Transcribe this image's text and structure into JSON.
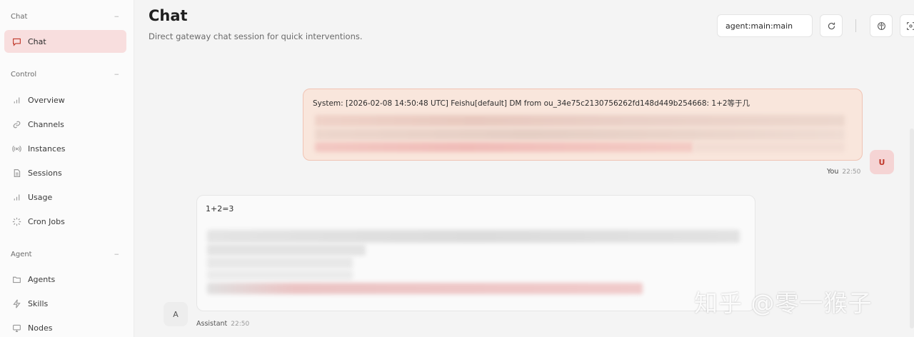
{
  "sidebar": {
    "sections": [
      {
        "title": "Chat",
        "chevron": "−"
      },
      {
        "title": "Control",
        "chevron": "−"
      },
      {
        "title": "Agent",
        "chevron": "−"
      }
    ],
    "items": [
      {
        "label": "Chat",
        "icon": "chat-bubble-icon",
        "active": true
      },
      {
        "label": "Overview",
        "icon": "bar-chart-icon"
      },
      {
        "label": "Channels",
        "icon": "link-icon"
      },
      {
        "label": "Instances",
        "icon": "broadcast-icon"
      },
      {
        "label": "Sessions",
        "icon": "document-icon"
      },
      {
        "label": "Usage",
        "icon": "bar-chart-icon"
      },
      {
        "label": "Cron Jobs",
        "icon": "spinner-icon"
      },
      {
        "label": "Agents",
        "icon": "folder-icon"
      },
      {
        "label": "Skills",
        "icon": "lightning-icon"
      },
      {
        "label": "Nodes",
        "icon": "monitor-icon"
      }
    ]
  },
  "header": {
    "title": "Chat",
    "subtitle": "Direct gateway chat session for quick interventions.",
    "session_value": "agent:main:main"
  },
  "messages": {
    "user": {
      "text": "System: [2026-02-08 14:50:48 UTC] Feishu[default] DM from ou_34e75c2130756262fd148d449b254668: 1+2等于几",
      "avatar": "U",
      "sender": "You",
      "time": "22:50"
    },
    "assistant": {
      "text": "1+2=3",
      "avatar": "A",
      "sender": "Assistant",
      "time": "22:50"
    }
  },
  "watermark": "知乎 @零一猴子",
  "colors": {
    "accent": "#c0392b",
    "active_bg": "#f8dede",
    "user_bubble": "#f9e6dc",
    "user_border": "#f0c4b4"
  }
}
